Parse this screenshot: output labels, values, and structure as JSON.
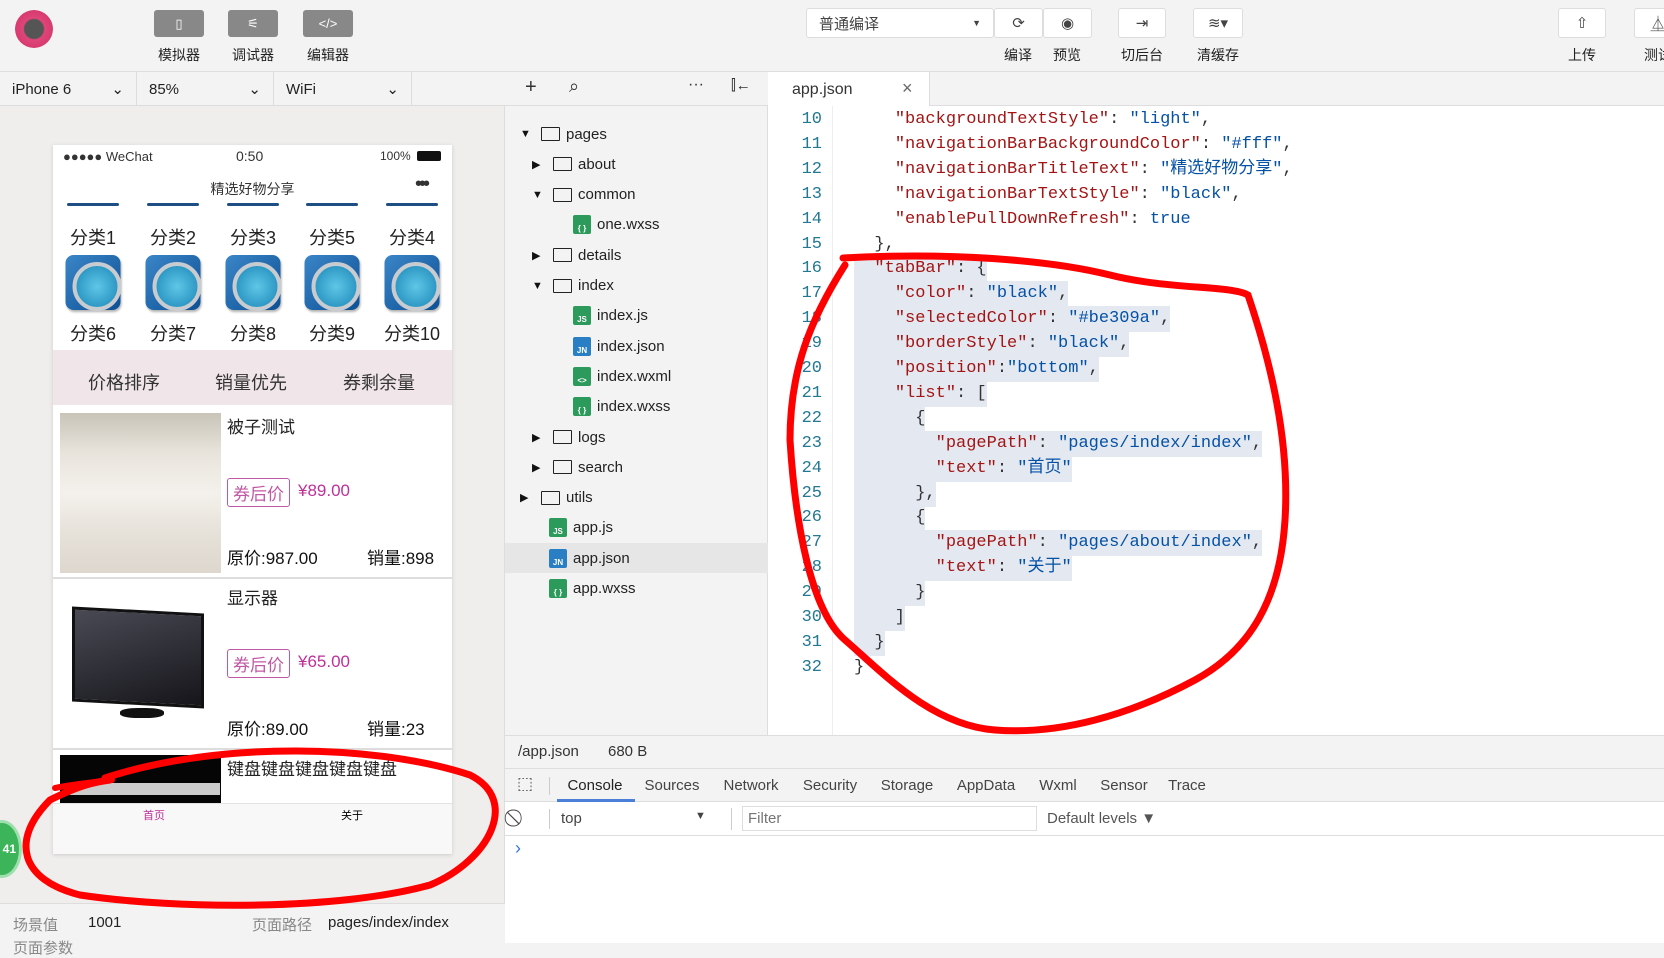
{
  "toolbar": {
    "left_buttons": [
      {
        "label": "模拟器",
        "icon": "phone-icon"
      },
      {
        "label": "调试器",
        "icon": "debug-icon"
      },
      {
        "label": "编辑器",
        "icon": "code-icon"
      }
    ],
    "compile_mode": "普通编译",
    "compile_label": "编译",
    "preview_label": "预览",
    "background_label": "切后台",
    "clear_cache_label": "清缓存",
    "upload_label": "上传",
    "test_label": "测试"
  },
  "simulator": {
    "device": "iPhone 6",
    "zoom": "85%",
    "network": "WiFi",
    "status_bar": {
      "carrier": "●●●●● WeChat",
      "time": "0:50",
      "battery": "100%"
    },
    "nav_title": "精选好物分享",
    "categories_row1": [
      "分类1",
      "分类2",
      "分类3",
      "分类5",
      "分类4"
    ],
    "categories_row2": [
      "分类6",
      "分类7",
      "分类8",
      "分类9",
      "分类10"
    ],
    "sort_options": [
      "价格排序",
      "销量优先",
      "券剩余量"
    ],
    "products": [
      {
        "title": "被子测试",
        "badge": "券后价",
        "price": "¥89.00",
        "original": "原价:987.00",
        "sales": "销量:898"
      },
      {
        "title": "显示器",
        "badge": "券后价",
        "price": "¥65.00",
        "original": "原价:89.00",
        "sales": "销量:23"
      },
      {
        "title": "键盘键盘键盘键盘键盘"
      }
    ],
    "tabbar": [
      {
        "label": "首页",
        "selected": true
      },
      {
        "label": "关于",
        "selected": false
      }
    ],
    "tabbar_colors": {
      "selected": "#be309a",
      "normal": "#000000"
    },
    "side_badge": "41",
    "scene_label": "场景值",
    "scene_value": "1001",
    "path_label": "页面路径",
    "path_value": "pages/index/index",
    "params_label": "页面参数"
  },
  "file_tree": [
    {
      "name": "pages",
      "type": "folder",
      "depth": 0,
      "open": true
    },
    {
      "name": "about",
      "type": "folder",
      "depth": 1,
      "open": false
    },
    {
      "name": "common",
      "type": "folder",
      "depth": 1,
      "open": true
    },
    {
      "name": "one.wxss",
      "type": "wxss",
      "depth": 2
    },
    {
      "name": "details",
      "type": "folder",
      "depth": 1,
      "open": false
    },
    {
      "name": "index",
      "type": "folder",
      "depth": 1,
      "open": true
    },
    {
      "name": "index.js",
      "type": "js",
      "depth": 2
    },
    {
      "name": "index.json",
      "type": "json",
      "depth": 2
    },
    {
      "name": "index.wxml",
      "type": "wxml",
      "depth": 2
    },
    {
      "name": "index.wxss",
      "type": "wxss",
      "depth": 2
    },
    {
      "name": "logs",
      "type": "folder",
      "depth": 1,
      "open": false
    },
    {
      "name": "search",
      "type": "folder",
      "depth": 1,
      "open": false
    },
    {
      "name": "utils",
      "type": "folder",
      "depth": 0,
      "open": false
    },
    {
      "name": "app.js",
      "type": "js",
      "depth": 0
    },
    {
      "name": "app.json",
      "type": "json",
      "depth": 0,
      "selected": true
    },
    {
      "name": "app.wxss",
      "type": "wxss",
      "depth": 0
    }
  ],
  "file_icon_labels": {
    "js": "JS",
    "json": "JN",
    "wxml": "<>",
    "wxss": "{ }"
  },
  "editor": {
    "tab": "app.json",
    "highlight_from": 16,
    "highlight_to": 31,
    "lines": [
      {
        "n": "10",
        "text": "    \"backgroundTextStyle\": \"light\","
      },
      {
        "n": "11",
        "text": "    \"navigationBarBackgroundColor\": \"#fff\","
      },
      {
        "n": "12",
        "text": "    \"navigationBarTitleText\": \"精选好物分享\","
      },
      {
        "n": "13",
        "text": "    \"navigationBarTextStyle\": \"black\","
      },
      {
        "n": "14",
        "text": "    \"enablePullDownRefresh\": true"
      },
      {
        "n": "15",
        "text": "  },"
      },
      {
        "n": "16",
        "text": "  \"tabBar\": {"
      },
      {
        "n": "17",
        "text": "    \"color\": \"black\","
      },
      {
        "n": "18",
        "text": "    \"selectedColor\": \"#be309a\","
      },
      {
        "n": "19",
        "text": "    \"borderStyle\": \"black\","
      },
      {
        "n": "20",
        "text": "    \"position\":\"bottom\","
      },
      {
        "n": "21",
        "text": "    \"list\": ["
      },
      {
        "n": "22",
        "text": "      {"
      },
      {
        "n": "23",
        "text": "        \"pagePath\": \"pages/index/index\","
      },
      {
        "n": "24",
        "text": "        \"text\": \"首页\""
      },
      {
        "n": "25",
        "text": "      },"
      },
      {
        "n": "26",
        "text": "      {"
      },
      {
        "n": "27",
        "text": "        \"pagePath\": \"pages/about/index\","
      },
      {
        "n": "28",
        "text": "        \"text\": \"关于\""
      },
      {
        "n": "29",
        "text": "      }"
      },
      {
        "n": "30",
        "text": "    ]"
      },
      {
        "n": "31",
        "text": "  }"
      },
      {
        "n": "32",
        "text": "}"
      }
    ]
  },
  "status": {
    "path": "/app.json",
    "size": "680 B"
  },
  "devtools": {
    "tabs": [
      "Console",
      "Sources",
      "Network",
      "Security",
      "Storage",
      "AppData",
      "Wxml",
      "Sensor",
      "Trace"
    ],
    "active_tab": "Console",
    "context": "top",
    "filter_placeholder": "Filter",
    "levels": "Default levels ▼",
    "prompt": "›"
  },
  "colors": {
    "accent": "#be309a",
    "annotation": "#ff0000",
    "tab_underline": "#4a80d8"
  }
}
